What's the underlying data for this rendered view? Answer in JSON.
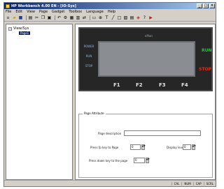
{
  "window": {
    "title": "HP Workbench 4.00 EN - [IO-Sys]"
  },
  "menu": [
    "File",
    "Edit",
    "View",
    "Page",
    "Gadget",
    "Toolbox",
    "Language",
    "Help"
  ],
  "toolbar_icons": [
    "new-icon",
    "open-icon",
    "save-icon",
    "print-icon",
    "cut-icon",
    "copy-icon",
    "paste-icon",
    "undo-icon",
    "compile-icon",
    "download-icon",
    "upload-icon",
    "connect-icon",
    "monitor-icon",
    "zoom-icon",
    "text-icon",
    "line-icon",
    "rect-icon",
    "image-icon",
    "table-icon",
    "settings-icon",
    "help-icon",
    "arrow-icon"
  ],
  "tree": {
    "root": "View/Sys",
    "child": "Page1"
  },
  "device": {
    "brand": "ePlan",
    "left_labels": [
      "POWER",
      "RUN",
      "STOP"
    ],
    "run_label": "RUN",
    "stop_label": "STOP",
    "fkeys": [
      "F1",
      "F2",
      "F3",
      "F4"
    ]
  },
  "page_attribute": {
    "legend": "Page Attribute",
    "description_label": "Page description",
    "description_value": "",
    "press_fkey_label": "Press fp key to Page",
    "press_fkey_value": "0",
    "display_level_label": "Display level",
    "display_level_value": "0",
    "press_down_label": "Press down key to the page",
    "press_down_value": "0"
  },
  "status": [
    "CAL",
    "NUM",
    "CAP",
    "SCRL"
  ]
}
